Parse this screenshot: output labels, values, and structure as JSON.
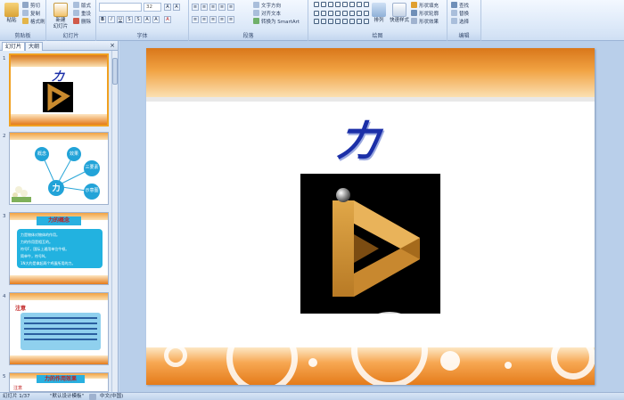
{
  "ribbon": {
    "groups": {
      "clipboard": "剪贴板",
      "slides": "幻灯片",
      "font": "字体",
      "paragraph": "段落",
      "drawing": "绘图",
      "editing": "编辑"
    },
    "clipboard": {
      "paste": "粘贴",
      "cut": "剪切",
      "copy": "复制",
      "format_painter": "格式刷"
    },
    "slides": {
      "new_slide": "新建\n幻灯片",
      "layout": "版式",
      "reset": "重设",
      "delete": "删除"
    },
    "font": {
      "font_size": "32"
    },
    "paragraph": {
      "text_direction": "文字方向",
      "align_text": "对齐文本",
      "smartart": "转换为 SmartArt"
    },
    "drawing": {
      "arrange": "排列",
      "quick_styles": "快速样式",
      "shape_fill": "形状填充",
      "shape_outline": "形状轮廓",
      "shape_effects": "形状效果"
    },
    "editing": {
      "find": "查找",
      "replace": "替换",
      "select": "选择"
    }
  },
  "panel": {
    "tab_slides": "幻灯片",
    "tab_outline": "大纲",
    "close": "×",
    "thumb1": {
      "num": "1",
      "title": "力"
    },
    "thumb2": {
      "num": "2",
      "center": "力",
      "concept": "概念",
      "effect": "效果",
      "three": "三要素",
      "fig": "示意图"
    },
    "thumb3": {
      "num": "3",
      "title": "力的概念",
      "lines": [
        "力是物体对物体的作用。",
        "力的作用是相互的。",
        "符号F，国际上通用单位牛顿。",
        "简单牛，符号N。",
        "1N大约是拿起两个鸡蛋所用的力。"
      ]
    },
    "thumb4": {
      "num": "4",
      "title": "注意"
    },
    "thumb5": {
      "num": "5",
      "title": "力的作用效果",
      "label": "注意"
    }
  },
  "slide": {
    "title": "力"
  },
  "status": {
    "slide_info": "幻灯片 1/37",
    "theme": "\"默认设计模板\"",
    "language": "中文(中国)"
  },
  "colors": {
    "accent_orange": "#f1a242",
    "title_blue": "#1b2fa8",
    "ribbon_bg": "#dbe8f8"
  }
}
